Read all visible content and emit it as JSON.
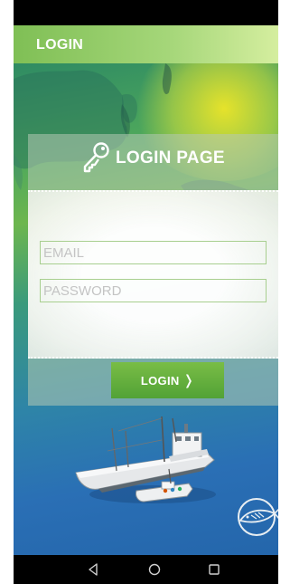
{
  "app_bar": {
    "title": "LOGIN"
  },
  "login_card": {
    "title": "LOGIN PAGE",
    "icon": "key-icon",
    "email_placeholder": "EMAIL",
    "email_value": "",
    "password_placeholder": "PASSWORD",
    "password_value": "",
    "login_button_label": "LOGIN",
    "login_button_icon": "chevron-right-icon"
  },
  "logo_icon": "sardine-logo-icon",
  "nav_bar": {
    "back_icon": "back-triangle-icon",
    "home_icon": "home-circle-icon",
    "recent_icon": "recent-square-icon"
  },
  "colors": {
    "accent_green": "#6cb53f",
    "app_bar_green": "#8cc862",
    "input_border": "#a8cf8f"
  }
}
